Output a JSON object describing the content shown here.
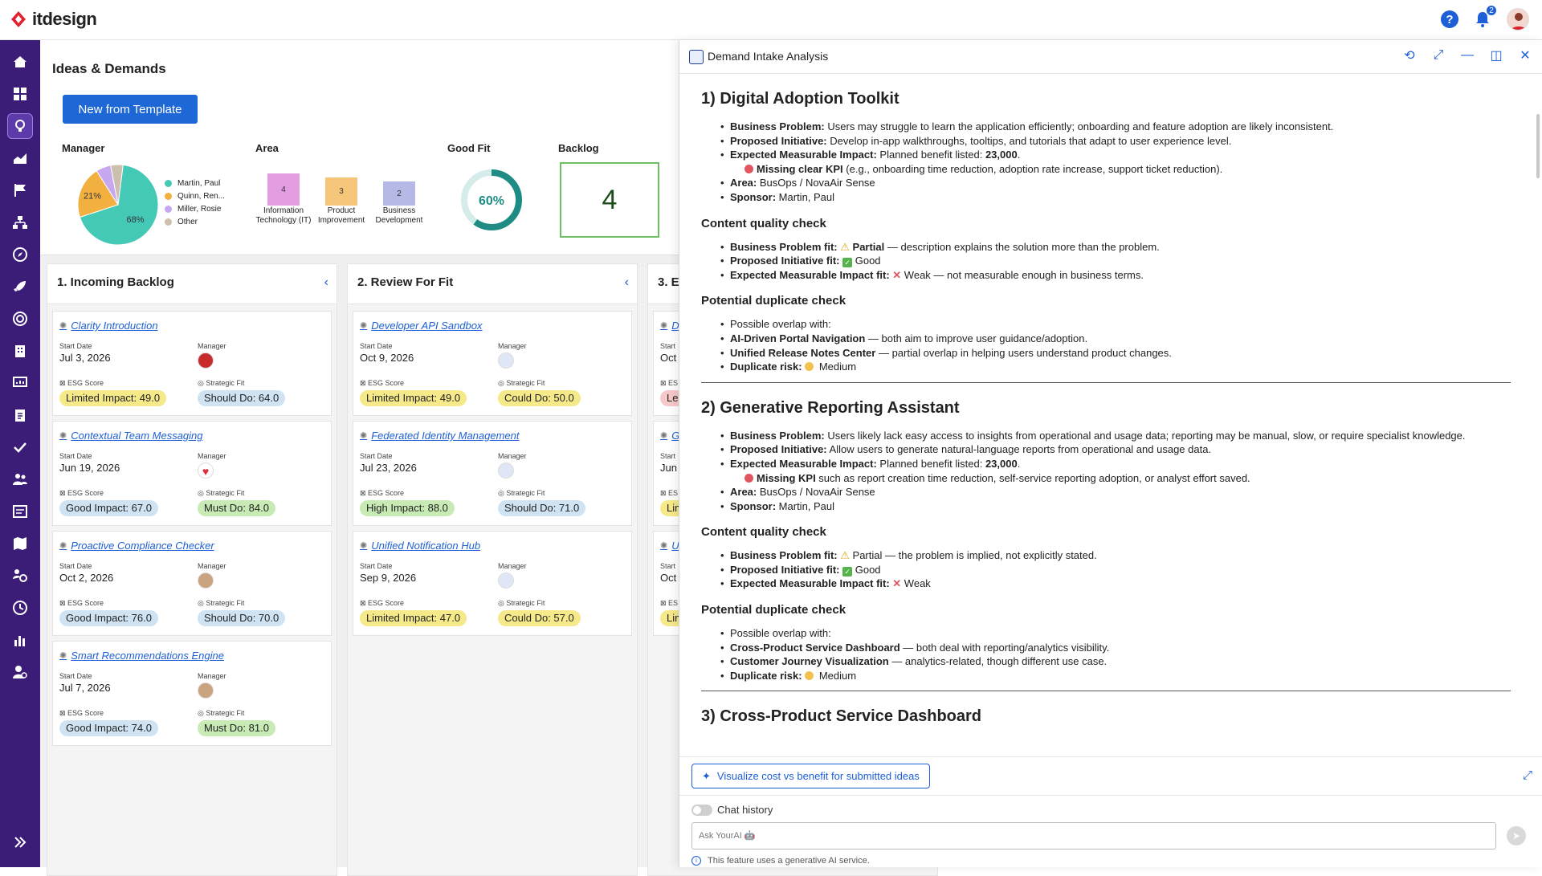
{
  "app": {
    "logo_text": "itdesign"
  },
  "topbar": {
    "notification_count": "2"
  },
  "page": {
    "title": "Ideas & Demands",
    "new_button": "New from Template"
  },
  "widgets": {
    "manager": {
      "label": "Manager",
      "slices": [
        {
          "name": "Martin, Paul",
          "percent": 68,
          "label": "68%",
          "color": "#45c9b7"
        },
        {
          "name": "Quinn, Ren...",
          "percent": 21,
          "label": "21%",
          "color": "#f2b040"
        },
        {
          "name": "Miller, Rosie",
          "percent": 6,
          "label": "",
          "color": "#c7a8f0"
        },
        {
          "name": "Other",
          "percent": 5,
          "label": "",
          "color": "#cdbfae"
        }
      ]
    },
    "area": {
      "label": "Area",
      "bars": [
        {
          "value": "4",
          "caption": "Information Technology (IT)",
          "color": "#e39de0"
        },
        {
          "value": "3",
          "caption": "Product Improvement",
          "color": "#f5c57a"
        },
        {
          "value": "2",
          "caption": "Business Development",
          "color": "#b5b9e6"
        }
      ]
    },
    "good_fit": {
      "label": "Good Fit",
      "value": "60%",
      "percent": 60
    },
    "backlog": {
      "label": "Backlog",
      "value": "4"
    }
  },
  "columns": [
    {
      "title": "1. Incoming Backlog",
      "cards": [
        {
          "title": "Clarity Introduction",
          "start_label": "Start Date",
          "start": "Jul 3, 2026",
          "mgr_label": "Manager",
          "esg_label": "ESG Score",
          "esg": "Limited Impact: 49.0",
          "esg_color": "yellow",
          "fit_label": "Strategic Fit",
          "fit": "Should Do: 64.0",
          "fit_color": "blue",
          "avatar": "red"
        },
        {
          "title": "Contextual Team Messaging",
          "start_label": "Start Date",
          "start": "Jun 19, 2026",
          "mgr_label": "Manager",
          "esg_label": "ESG Score",
          "esg": "Good Impact: 67.0",
          "esg_color": "blue",
          "fit_label": "Strategic Fit",
          "fit": "Must Do: 84.0",
          "fit_color": "green",
          "avatar": "heart"
        },
        {
          "title": "Proactive Compliance Checker",
          "start_label": "Start Date",
          "start": "Oct 2, 2026",
          "mgr_label": "Manager",
          "esg_label": "ESG Score",
          "esg": "Good Impact: 76.0",
          "esg_color": "blue",
          "fit_label": "Strategic Fit",
          "fit": "Should Do: 70.0",
          "fit_color": "blue",
          "avatar": "tan"
        },
        {
          "title": "Smart Recommendations Engine",
          "start_label": "Start Date",
          "start": "Jul 7, 2026",
          "mgr_label": "Manager",
          "esg_label": "ESG Score",
          "esg": "Good Impact: 74.0",
          "esg_color": "blue",
          "fit_label": "Strategic Fit",
          "fit": "Must Do: 81.0",
          "fit_color": "green",
          "avatar": "tan"
        }
      ]
    },
    {
      "title": "2. Review For Fit",
      "cards": [
        {
          "title": "Developer API Sandbox",
          "start_label": "Start Date",
          "start": "Oct 9, 2026",
          "mgr_label": "Manager",
          "esg_label": "ESG Score",
          "esg": "Limited Impact: 49.0",
          "esg_color": "yellow",
          "fit_label": "Strategic Fit",
          "fit": "Could Do: 50.0",
          "fit_color": "yellow",
          "avatar": "blue"
        },
        {
          "title": "Federated Identity Management",
          "start_label": "Start Date",
          "start": "Jul 23, 2026",
          "mgr_label": "Manager",
          "esg_label": "ESG Score",
          "esg": "High Impact: 88.0",
          "esg_color": "green",
          "fit_label": "Strategic Fit",
          "fit": "Should Do: 71.0",
          "fit_color": "blue",
          "avatar": "blue"
        },
        {
          "title": "Unified Notification Hub",
          "start_label": "Start Date",
          "start": "Sep 9, 2026",
          "mgr_label": "Manager",
          "esg_label": "ESG Score",
          "esg": "Limited Impact: 47.0",
          "esg_color": "yellow",
          "fit_label": "Strategic Fit",
          "fit": "Could Do: 57.0",
          "fit_color": "yellow",
          "avatar": "blue"
        }
      ]
    },
    {
      "title": "3. E",
      "cards": [
        {
          "title": "D",
          "start_label": "Start",
          "start": "Oct 2",
          "mgr_label": "",
          "esg_label": "ES",
          "esg": "Le",
          "esg_color": "red",
          "fit_label": "",
          "fit": "",
          "fit_color": "",
          "avatar": ""
        },
        {
          "title": "G",
          "start_label": "Start",
          "start": "Jun 1",
          "mgr_label": "",
          "esg_label": "ES",
          "esg": "Lim",
          "esg_color": "yellow",
          "fit_label": "",
          "fit": "",
          "fit_color": "",
          "avatar": ""
        },
        {
          "title": "U",
          "start_label": "Start",
          "start": "Oct",
          "mgr_label": "",
          "esg_label": "ES",
          "esg": "Lim",
          "esg_color": "yellow",
          "fit_label": "",
          "fit": "",
          "fit_color": "",
          "avatar": ""
        }
      ]
    }
  ],
  "panel": {
    "title": "Demand Intake Analysis",
    "suggestion": "Visualize cost vs benefit for submitted ideas",
    "chat_history": "Chat history",
    "input_placeholder": "Ask YourAI 🤖",
    "disclaimer": "This feature uses a generative AI service.",
    "sections": [
      {
        "heading": "1) Digital Adoption Toolkit",
        "l1": "Business Problem:",
        "v1": " Users may struggle to learn the application efficiently; onboarding and feature adoption are likely inconsistent.",
        "l2": "Proposed Initiative:",
        "v2": " Develop in-app walkthroughs, tooltips, and tutorials that adapt to user experience level.",
        "l3": "Expected Measurable Impact:",
        "v3a": " Planned benefit listed: ",
        "v3b": "23,000",
        "v3c": ".",
        "kpi_l": "Missing clear KPI",
        "kpi_v": " (e.g., onboarding time reduction, adoption rate increase, support ticket reduction).",
        "l4": "Area:",
        "v4": " BusOps / NovaAir Sense",
        "l5": "Sponsor:",
        "v5": " Martin, Paul",
        "cq_heading": "Content quality check",
        "c1": "Business Problem fit:",
        "c1v": " Partial",
        "c1r": " — description explains the solution more than the problem.",
        "c2": "Proposed Initiative fit:",
        "c2v": " Good",
        "c3": "Expected Measurable Impact fit:",
        "c3v": " Weak — not measurable enough in business terms.",
        "dup_heading": "Potential duplicate check",
        "d0": "Possible overlap with:",
        "d1": "AI-Driven Portal Navigation",
        "d1v": " — both aim to improve user guidance/adoption.",
        "d2": "Unified Release Notes Center",
        "d2v": " — partial overlap in helping users understand product changes.",
        "d3": "Duplicate risk:",
        "d3v": " Medium"
      },
      {
        "heading": "2) Generative Reporting Assistant",
        "l1": "Business Problem:",
        "v1": " Users likely lack easy access to insights from operational and usage data; reporting may be manual, slow, or require specialist knowledge.",
        "l2": "Proposed Initiative:",
        "v2": " Allow users to generate natural-language reports from operational and usage data.",
        "l3": "Expected Measurable Impact:",
        "v3a": " Planned benefit listed: ",
        "v3b": "23,000",
        "v3c": ".",
        "kpi_l": "Missing KPI",
        "kpi_v": " such as report creation time reduction, self-service reporting adoption, or analyst effort saved.",
        "l4": "Area:",
        "v4": " BusOps / NovaAir Sense",
        "l5": "Sponsor:",
        "v5": " Martin, Paul",
        "cq_heading": "Content quality check",
        "c1": "Business Problem fit:",
        "c1v": " Partial",
        "c1r": " — the problem is implied, not explicitly stated.",
        "c2": "Proposed Initiative fit:",
        "c2v": " Good",
        "c3": "Expected Measurable Impact fit:",
        "c3v": " Weak",
        "dup_heading": "Potential duplicate check",
        "d0": "Possible overlap with:",
        "d1": "Cross-Product Service Dashboard",
        "d1v": " — both deal with reporting/analytics visibility.",
        "d2": "Customer Journey Visualization",
        "d2v": " — analytics-related, though different use case.",
        "d3": "Duplicate risk:",
        "d3v": " Medium"
      }
    ],
    "third_heading": "3) Cross-Product Service Dashboard"
  }
}
